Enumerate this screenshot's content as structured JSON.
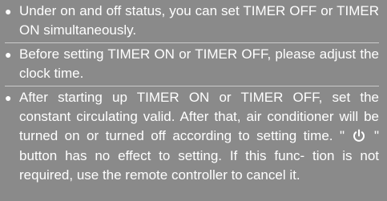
{
  "notes": [
    {
      "bullet": "●",
      "text": "Under on and off status, you can set TIMER OFF or TIMER ON simultaneously."
    },
    {
      "bullet": "●",
      "text": "Before setting TIMER ON or TIMER OFF, please adjust the clock time."
    },
    {
      "bullet": "●",
      "text_before_icon": "After starting up TIMER ON or TIMER OFF, set the constant circulating valid. After that, air conditioner will be turned on or turned off according to setting time. \"",
      "icon": "power-icon",
      "text_after_icon": "\" button has no effect to setting. If this func- tion is not required, use the remote controller to cancel it."
    }
  ],
  "colors": {
    "background": "#8a8a8a",
    "text": "#ffffff"
  }
}
